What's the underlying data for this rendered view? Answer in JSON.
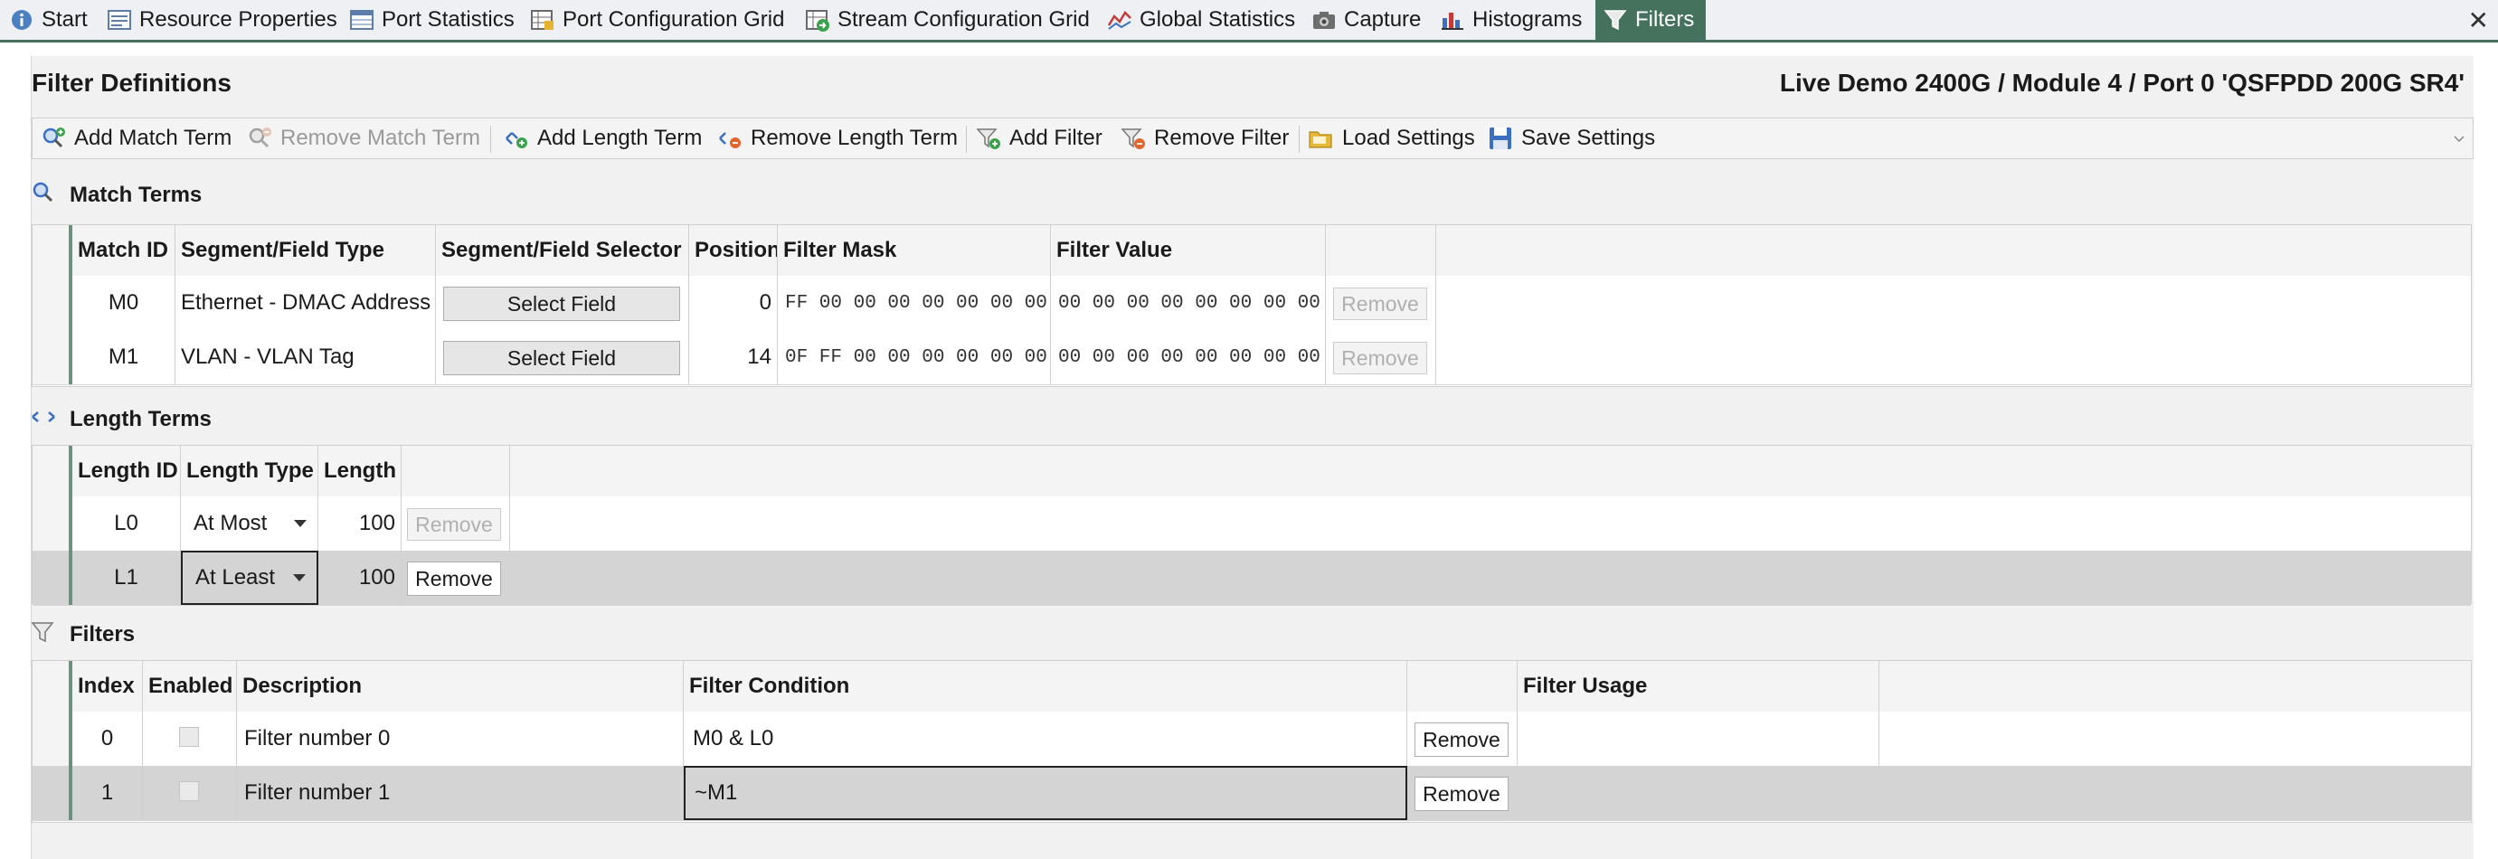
{
  "tabs": [
    {
      "label": "Start",
      "icon": "info-icon"
    },
    {
      "label": "Resource Properties",
      "icon": "properties-icon"
    },
    {
      "label": "Port Statistics",
      "icon": "table-icon"
    },
    {
      "label": "Port Configuration Grid",
      "icon": "grid-icon"
    },
    {
      "label": "Stream Configuration Grid",
      "icon": "grid-arrow-icon"
    },
    {
      "label": "Global Statistics",
      "icon": "line-chart-icon"
    },
    {
      "label": "Capture",
      "icon": "camera-icon"
    },
    {
      "label": "Histograms",
      "icon": "histogram-icon"
    },
    {
      "label": "Filters",
      "icon": "filter-icon",
      "active": true
    }
  ],
  "close_symbol": "✕",
  "header": {
    "title": "Filter Definitions",
    "port": "Live Demo 2400G / Module 4 / Port 0 'QSFPDD 200G SR4'"
  },
  "toolbar": {
    "add_match_term": "Add Match Term",
    "remove_match_term": "Remove Match Term",
    "add_length_term": "Add Length Term",
    "remove_length_term": "Remove Length Term",
    "add_filter": "Add Filter",
    "remove_filter": "Remove Filter",
    "load_settings": "Load Settings",
    "save_settings": "Save Settings"
  },
  "match_terms": {
    "title": "Match Terms",
    "columns": [
      "Match ID",
      "Segment/Field Type",
      "Segment/Field Selector",
      "Position",
      "Filter Mask",
      "Filter Value"
    ],
    "rows": [
      {
        "id": "M0",
        "type": "Ethernet - DMAC Address",
        "selector": "Select Field",
        "position": "0",
        "mask": "FF 00 00 00 00 00 00 00",
        "value": "00 00 00 00 00 00 00 00",
        "remove": "Remove"
      },
      {
        "id": "M1",
        "type": "VLAN - VLAN Tag",
        "selector": "Select Field",
        "position": "14",
        "mask": "0F FF 00 00 00 00 00 00",
        "value": "00 00 00 00 00 00 00 00",
        "remove": "Remove"
      }
    ]
  },
  "length_terms": {
    "title": "Length Terms",
    "columns": [
      "Length ID",
      "Length Type",
      "Length"
    ],
    "rows": [
      {
        "id": "L0",
        "type": "At Most",
        "length": "100",
        "remove": "Remove"
      },
      {
        "id": "L1",
        "type": "At Least",
        "length": "100",
        "remove": "Remove"
      }
    ]
  },
  "filters": {
    "title": "Filters",
    "columns": [
      "Index",
      "Enabled",
      "Description",
      "Filter Condition",
      "",
      "Filter Usage"
    ],
    "rows": [
      {
        "index": "0",
        "enabled": false,
        "description": "Filter number 0",
        "condition": "M0 & L0",
        "remove": "Remove"
      },
      {
        "index": "1",
        "enabled": false,
        "description": "Filter number 1",
        "condition": "~M1",
        "remove": "Remove"
      }
    ]
  },
  "colors": {
    "accent": "#44725c",
    "selected_row": "#d4d4d4"
  }
}
